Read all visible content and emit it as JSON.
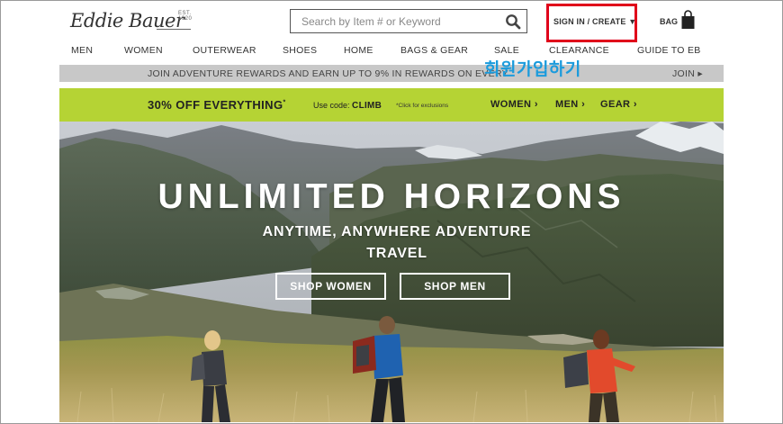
{
  "header": {
    "logo_text": "Eddie Bauer",
    "logo_est": "EST. 1920",
    "search_placeholder": "Search by Item # or Keyword",
    "signin_label": "SIGN IN / CREATE",
    "signin_caret": "▼",
    "bag_label": "BAG"
  },
  "nav": [
    "MEN",
    "WOMEN",
    "OUTERWEAR",
    "SHOES",
    "HOME",
    "BAGS & GEAR",
    "SALE",
    "CLEARANCE",
    "GUIDE TO EB"
  ],
  "rewards_bar": {
    "text_left": "JOIN ADVENTURE REWARDS AND EARN UP TO 9% IN REWARDS ON EVERY",
    "text_right": "JOIN ▸"
  },
  "annotation": {
    "korean_label": "회원가입하기",
    "highlight_color": "#e0001a"
  },
  "promo": {
    "headline": "30% OFF EVERYTHING",
    "headline_mark": "*",
    "code_prefix": "Use code:",
    "code": "CLIMB",
    "exclusions": "*Click for exclusions",
    "links": [
      "WOMEN ›",
      "MEN ›",
      "GEAR ›"
    ],
    "bg_color": "#b5d334"
  },
  "hero": {
    "title": "UNLIMITED HORIZONS",
    "subtitle": "ANYTIME, ANYWHERE ADVENTURE TRAVEL",
    "buttons": [
      "SHOP WOMEN",
      "SHOP MEN"
    ]
  }
}
